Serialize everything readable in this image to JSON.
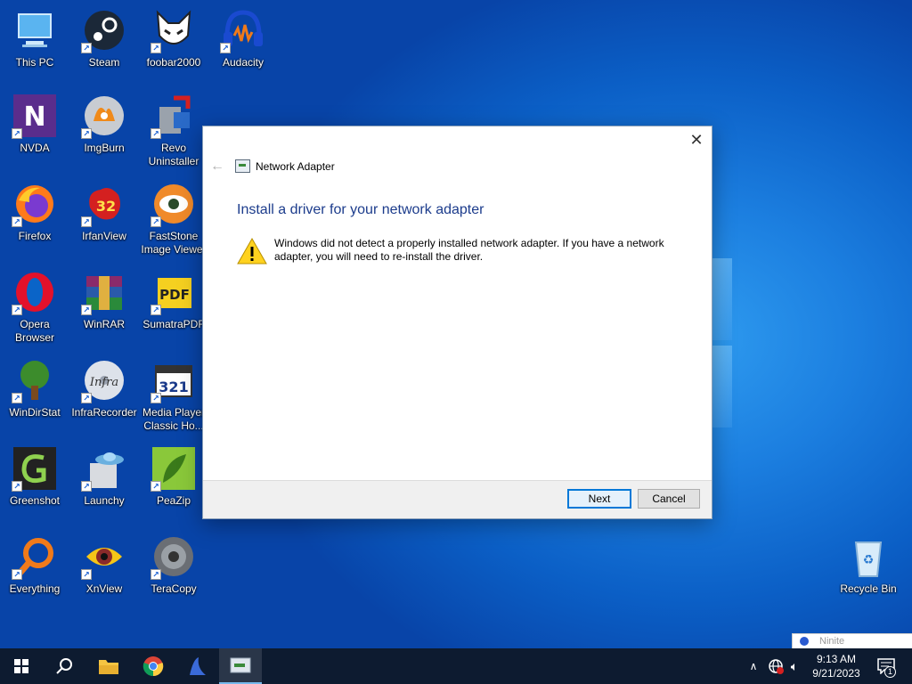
{
  "desktop": {
    "icons": [
      {
        "label": "This PC"
      },
      {
        "label": "Steam"
      },
      {
        "label": "foobar2000"
      },
      {
        "label": "Audacity"
      },
      {
        "label": "NVDA"
      },
      {
        "label": "ImgBurn"
      },
      {
        "label": "Revo Uninstaller"
      },
      {
        "label": "Firefox"
      },
      {
        "label": "IrfanView"
      },
      {
        "label": "FastStone Image Viewer"
      },
      {
        "label": "Opera Browser"
      },
      {
        "label": "WinRAR"
      },
      {
        "label": "SumatraPDF"
      },
      {
        "label": "WinDirStat"
      },
      {
        "label": "InfraRecorder"
      },
      {
        "label": "Media Player Classic Ho..."
      },
      {
        "label": "Greenshot"
      },
      {
        "label": "Launchy"
      },
      {
        "label": "PeaZip"
      },
      {
        "label": "Everything"
      },
      {
        "label": "XnView"
      },
      {
        "label": "TeraCopy"
      },
      {
        "label": "Recycle Bin"
      }
    ]
  },
  "dialog": {
    "header_title": "Network Adapter",
    "heading": "Install a driver for your network adapter",
    "message": "Windows did not detect a properly installed network adapter. If you have a network adapter, you will need to re-install the driver.",
    "next_label": "Next",
    "cancel_label": "Cancel",
    "close_glyph": "✕",
    "back_glyph": "←"
  },
  "taskbar": {
    "time": "9:13 AM",
    "date": "9/21/2023",
    "notification_count": "1",
    "popup_text": "Ninite"
  }
}
